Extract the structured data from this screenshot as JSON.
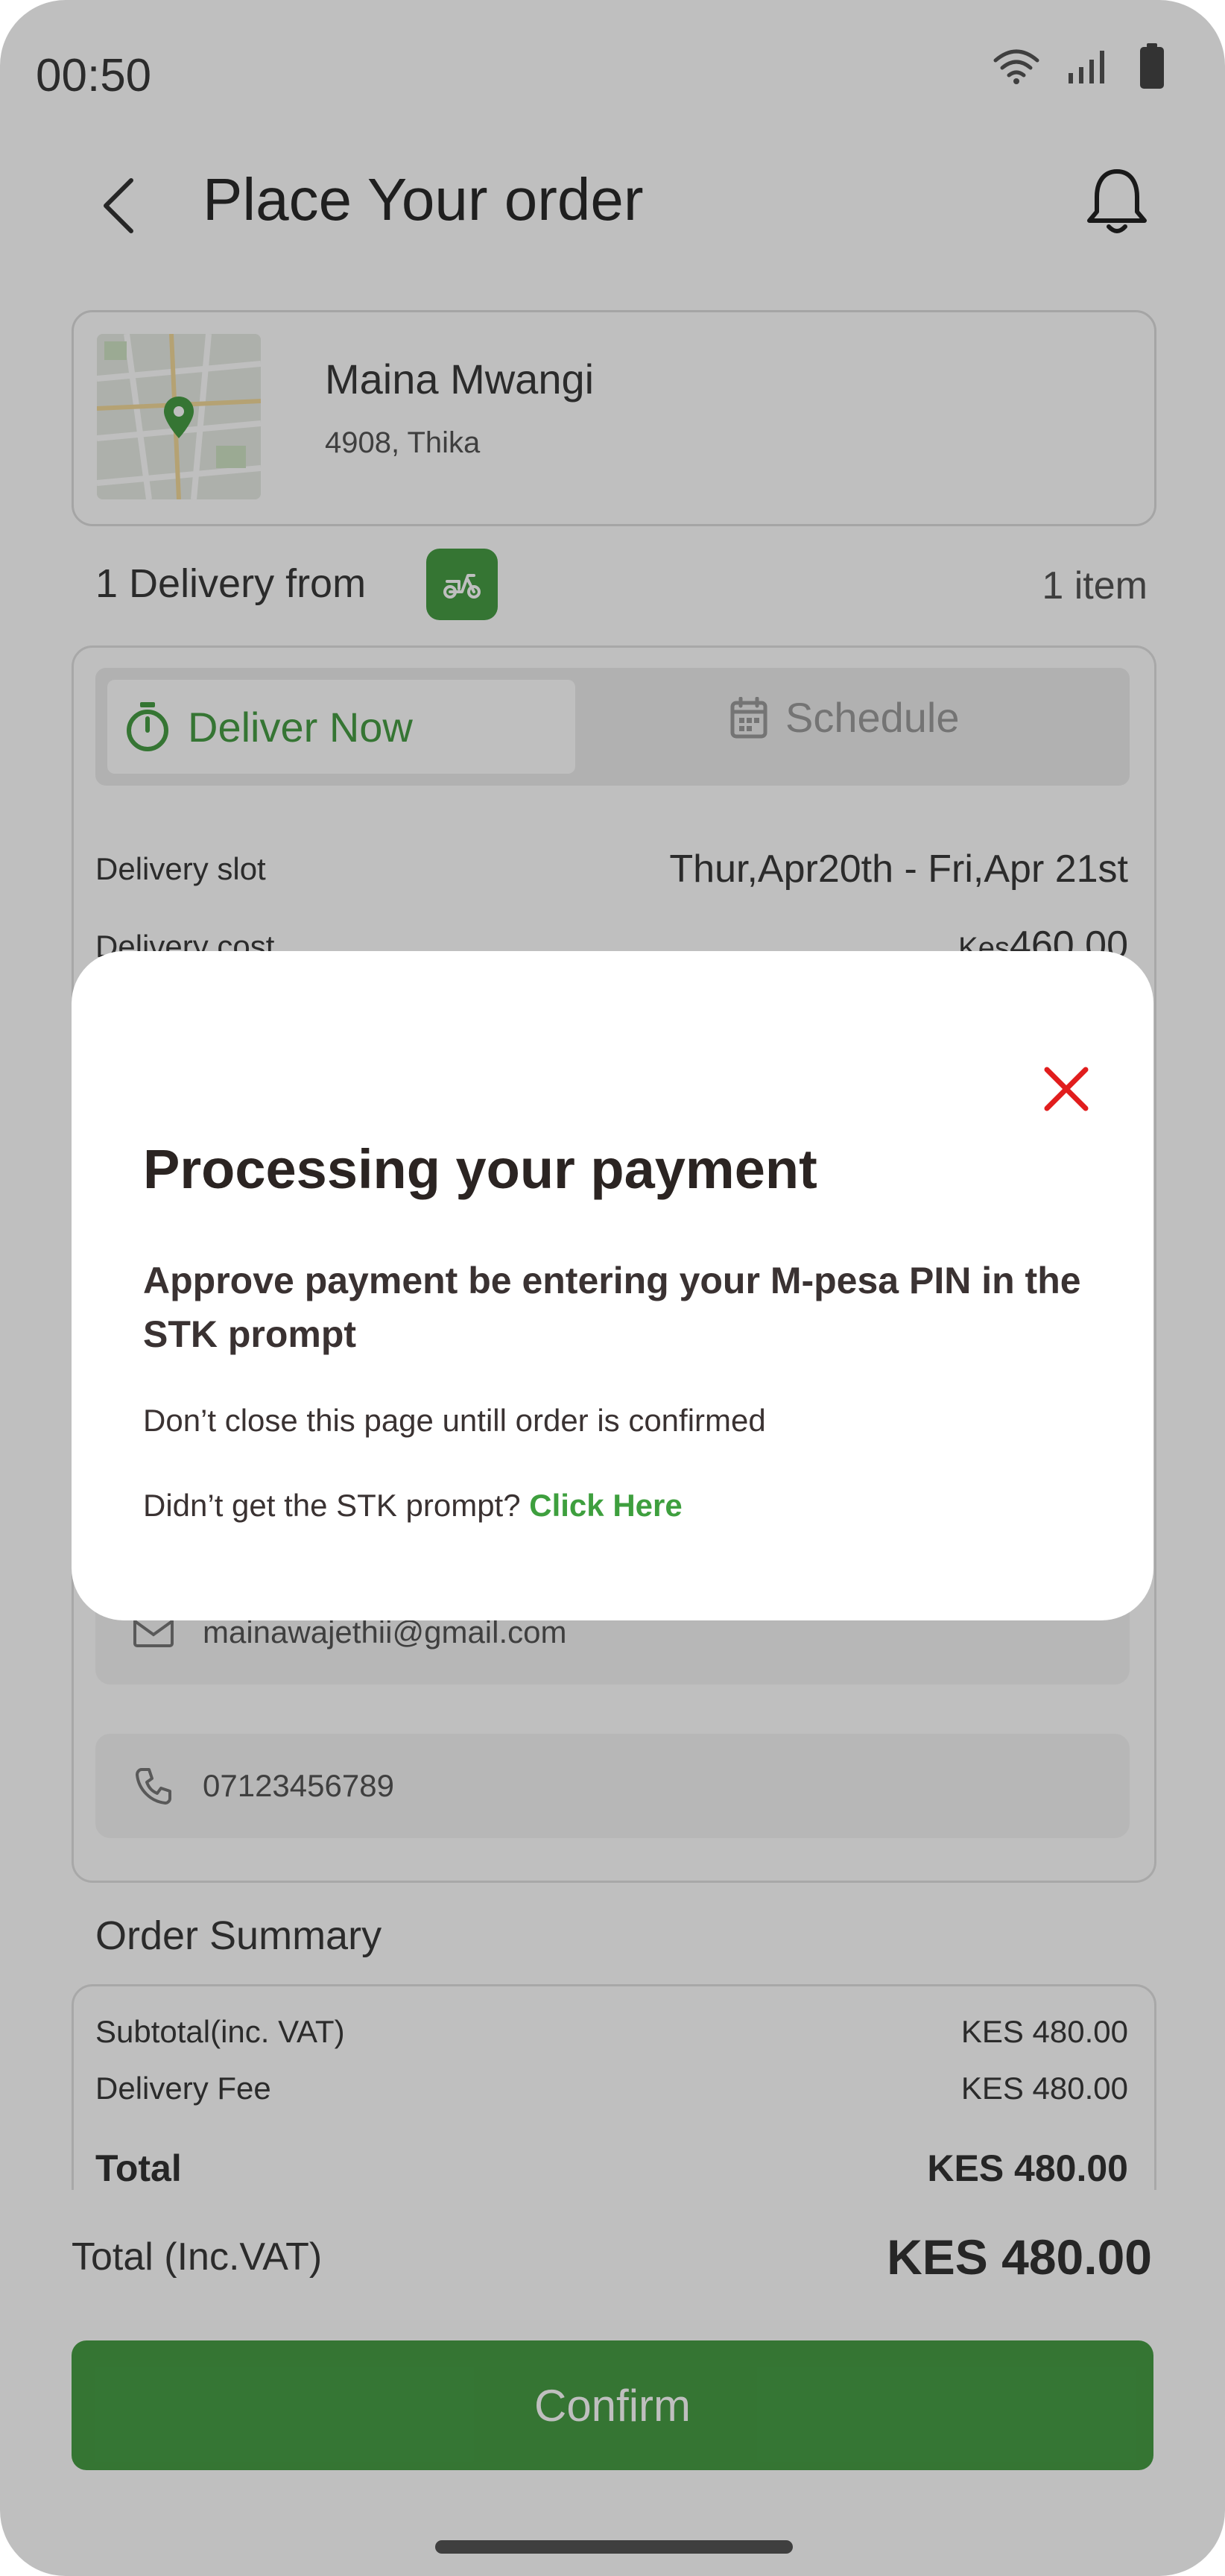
{
  "status_bar": {
    "time": "00:50"
  },
  "header": {
    "title": "Place Your order"
  },
  "address": {
    "name": "Maina Mwangi",
    "line": "4908, Thika"
  },
  "delivery": {
    "from_label": "1 Delivery from",
    "item_count": "1 item",
    "tabs": {
      "now": "Deliver Now",
      "schedule": "Schedule"
    },
    "slot_label": "Delivery slot",
    "slot_value": "Thur,Apr20th - Fri,Apr 21st",
    "cost_label": "Delivery cost",
    "cost_currency": "Kes",
    "cost_value": "460.00"
  },
  "contact": {
    "email": "mainawajethii@gmail.com",
    "phone": "07123456789"
  },
  "order_summary": {
    "title": "Order Summary",
    "rows": [
      {
        "label": "Subtotal(inc. VAT)",
        "value": "KES 480.00"
      },
      {
        "label": "Delivery Fee",
        "value": "KES 480.00"
      },
      {
        "label": "Total",
        "value": "KES 480.00"
      }
    ]
  },
  "bottom": {
    "total_label": "Total (Inc.VAT)",
    "total_value": "KES 480.00",
    "confirm_label": "Confirm"
  },
  "modal": {
    "title": "Processing your payment",
    "subtitle": "Approve payment be entering your M-pesa PIN in the STK prompt",
    "note": "Don’t close this page untill order is confirmed",
    "stk_question": "Didn’t get the STK prompt?",
    "stk_link": "Click Here"
  },
  "colors": {
    "primary_green": "#479d45",
    "link_green": "#3e9f3e",
    "close_red": "#e11d1d",
    "overlay": "rgba(0,0,0,0.25)"
  },
  "icons": [
    "wifi-icon",
    "signal-icon",
    "battery-icon",
    "back-arrow-icon",
    "bell-icon",
    "map-pin-icon",
    "scooter-icon",
    "timer-icon",
    "calendar-icon",
    "mail-icon",
    "phone-icon",
    "close-icon"
  ]
}
